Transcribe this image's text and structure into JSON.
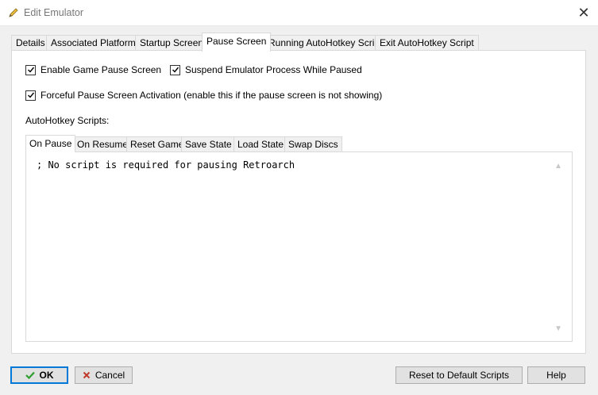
{
  "window": {
    "title": "Edit Emulator",
    "icon": "pencil-icon",
    "close_glyph": "✕"
  },
  "tabs": [
    {
      "label": "Details",
      "active": false
    },
    {
      "label": "Associated Platforms",
      "active": false
    },
    {
      "label": "Startup Screen",
      "active": false
    },
    {
      "label": "Pause Screen",
      "active": true
    },
    {
      "label": "Running AutoHotkey Script",
      "active": false
    },
    {
      "label": "Exit AutoHotkey Script",
      "active": false
    }
  ],
  "options": {
    "enable_pause": {
      "label": "Enable Game Pause Screen",
      "checked": true
    },
    "suspend_process": {
      "label": "Suspend Emulator Process While Paused",
      "checked": true
    },
    "forceful_activation": {
      "label": "Forceful Pause Screen Activation (enable this if the pause screen is not showing)",
      "checked": true
    }
  },
  "scripts": {
    "heading": "AutoHotkey Scripts:",
    "tabs": [
      {
        "label": "On Pause",
        "active": true
      },
      {
        "label": "On Resume",
        "active": false
      },
      {
        "label": "Reset Game",
        "active": false
      },
      {
        "label": "Save State",
        "active": false
      },
      {
        "label": "Load State",
        "active": false
      },
      {
        "label": "Swap Discs",
        "active": false
      }
    ],
    "content": "; No script is required for pausing Retroarch"
  },
  "buttons": {
    "ok": "OK",
    "cancel": "Cancel",
    "reset": "Reset to Default Scripts",
    "help": "Help"
  },
  "colors": {
    "accent": "#0078d7",
    "ok_check": "#2e9e2e",
    "cancel_x": "#c0392b"
  }
}
